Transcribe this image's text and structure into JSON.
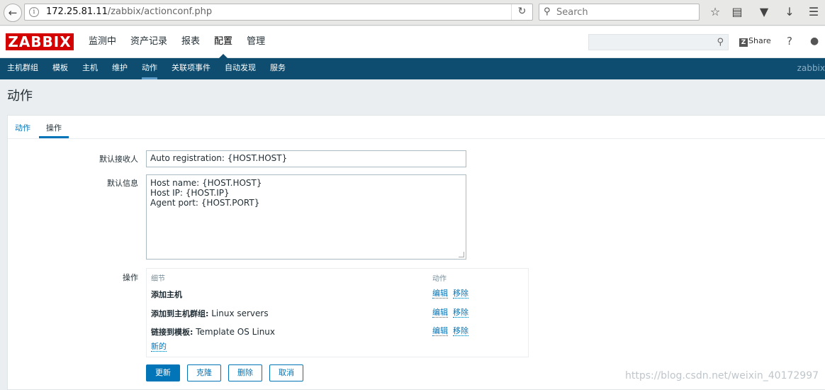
{
  "browser": {
    "url_host": "172.25.81.11",
    "url_path": "/zabbix/actionconf.php",
    "search_placeholder": "Search"
  },
  "header": {
    "logo": "ZABBIX",
    "menu": [
      "监测中",
      "资产记录",
      "报表",
      "配置",
      "管理"
    ],
    "share": "Share",
    "help": "?"
  },
  "subnav": {
    "items": [
      "主机群组",
      "模板",
      "主机",
      "维护",
      "动作",
      "关联项事件",
      "自动发现",
      "服务"
    ],
    "server": "zabbix"
  },
  "page": {
    "title": "动作",
    "tabs": [
      "动作",
      "操作"
    ]
  },
  "form": {
    "default_subject_label": "默认接收人",
    "default_subject_value": "Auto registration: {HOST.HOST}",
    "default_message_label": "默认信息",
    "default_message_value": "Host name: {HOST.HOST}\nHost IP: {HOST.IP}\nAgent port: {HOST.PORT}",
    "operations_label": "操作",
    "ops_header_details": "细节",
    "ops_header_action": "动作",
    "operations": [
      {
        "name": "添加主机",
        "target": ""
      },
      {
        "name": "添加到主机群组:",
        "target": " Linux servers"
      },
      {
        "name": "链接到模板:",
        "target": " Template OS Linux"
      }
    ],
    "edit_link": "编辑",
    "remove_link": "移除",
    "new_link": "新的"
  },
  "buttons": {
    "update": "更新",
    "clone": "克隆",
    "delete": "删除",
    "cancel": "取消"
  },
  "watermark": "https://blog.csdn.net/weixin_40172997"
}
